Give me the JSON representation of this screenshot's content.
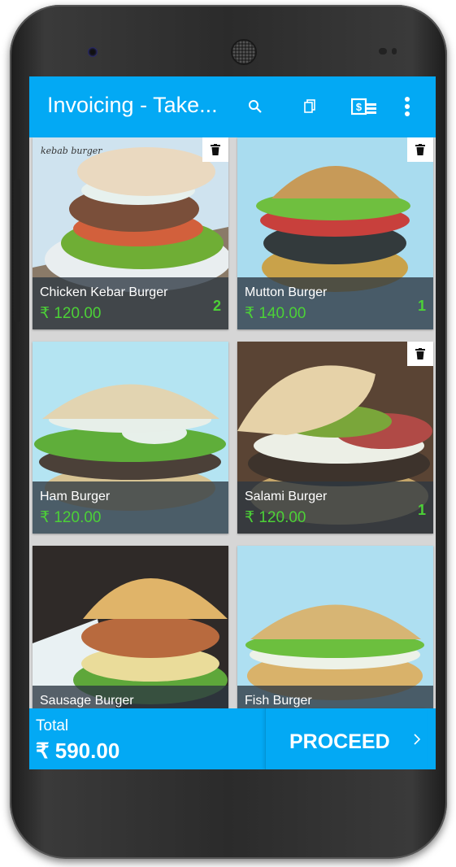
{
  "appbar": {
    "title": "Invoicing - Take...",
    "icons": [
      "search-icon",
      "copy-icon",
      "cash-register-icon",
      "more-vert-icon"
    ]
  },
  "products": [
    {
      "name": "Chicken Kebar Burger",
      "price": "₹ 120.00",
      "qty": "2",
      "image_caption": "kebab burger"
    },
    {
      "name": "Mutton Burger",
      "price": "₹ 140.00",
      "qty": "1"
    },
    {
      "name": "Ham Burger",
      "price": "₹ 120.00",
      "qty": ""
    },
    {
      "name": "Salami Burger",
      "price": "₹ 120.00",
      "qty": "1"
    },
    {
      "name": "Sausage Burger",
      "price": "",
      "qty": ""
    },
    {
      "name": "Fish Burger",
      "price": "",
      "qty": ""
    }
  ],
  "footer": {
    "total_label": "Total",
    "total_value": "₹ 590.00",
    "proceed_label": "PROCEED"
  },
  "colors": {
    "primary": "#03a9f4",
    "price_green": "#4cd137",
    "overlay": "#2d3741"
  }
}
